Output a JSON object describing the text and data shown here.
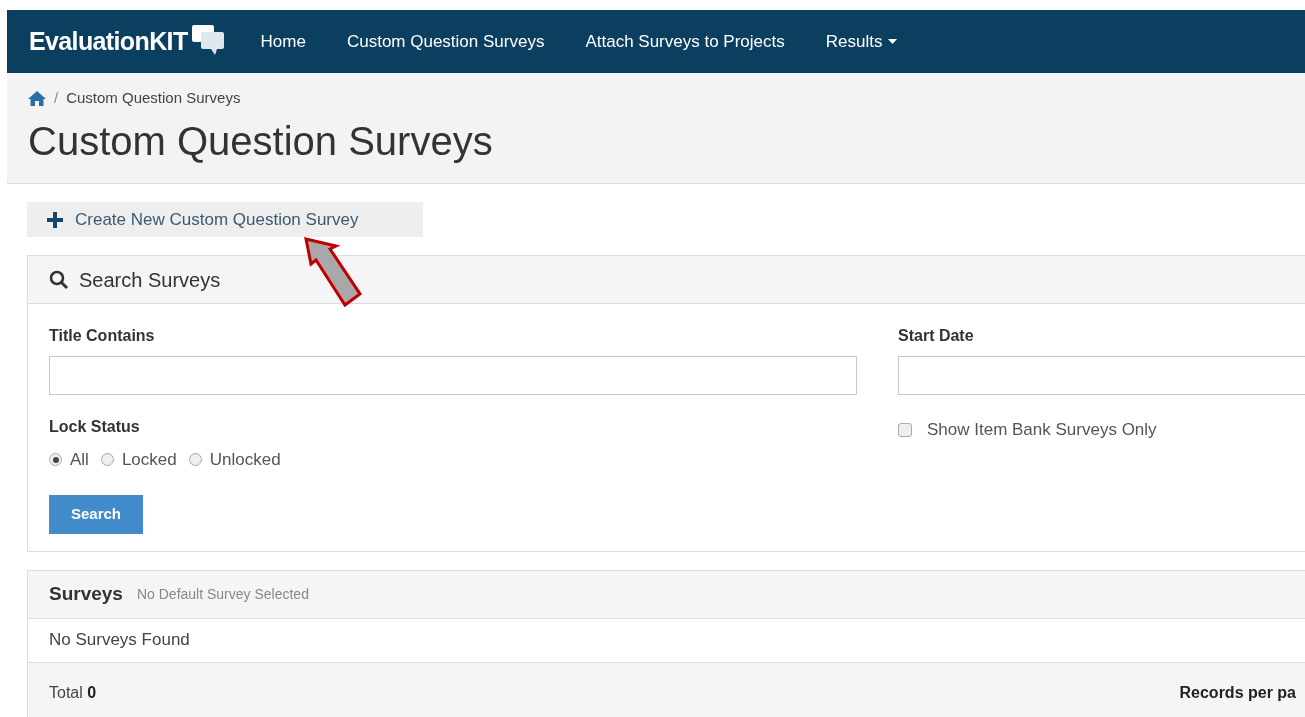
{
  "navbar": {
    "brand": "EvaluationKIT",
    "links": [
      {
        "label": "Home",
        "dropdown": false
      },
      {
        "label": "Custom Question Surveys",
        "dropdown": false
      },
      {
        "label": "Attach Surveys to Projects",
        "dropdown": false
      },
      {
        "label": "Results",
        "dropdown": true
      }
    ]
  },
  "breadcrumb": {
    "separator": "/",
    "items": [
      "Custom Question Surveys"
    ]
  },
  "page_title": "Custom Question Surveys",
  "create_button": "Create New Custom Question Survey",
  "search_panel": {
    "title": "Search Surveys",
    "title_field": {
      "label": "Title Contains"
    },
    "start_date_field": {
      "label": "Start Date"
    },
    "lock_status": {
      "label": "Lock Status",
      "options": [
        {
          "label": "All",
          "selected": true
        },
        {
          "label": "Locked",
          "selected": false
        },
        {
          "label": "Unlocked",
          "selected": false
        }
      ]
    },
    "item_bank_checkbox": {
      "label": "Show Item Bank Surveys Only",
      "checked": false
    },
    "search_button": "Search"
  },
  "surveys_panel": {
    "title": "Surveys",
    "subtitle": "No Default Survey Selected",
    "empty_message": "No Surveys Found",
    "total_label": "Total",
    "total_value": "0",
    "records_per_page_label": "Records per pa"
  }
}
